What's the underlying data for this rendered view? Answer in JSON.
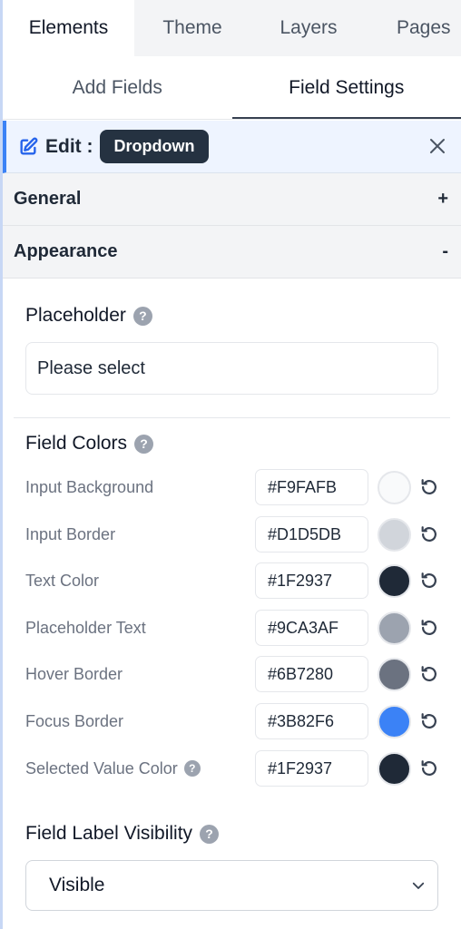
{
  "top_tabs": [
    "Elements",
    "Theme",
    "Layers",
    "Pages"
  ],
  "sub_tabs": [
    "Add Fields",
    "Field Settings"
  ],
  "edit": {
    "label": "Edit :",
    "badge": "Dropdown"
  },
  "accordions": [
    {
      "title": "General",
      "state": "+"
    },
    {
      "title": "Appearance",
      "state": "-"
    }
  ],
  "placeholder": {
    "title": "Placeholder",
    "value": "Please select"
  },
  "field_colors": {
    "title": "Field Colors",
    "rows": [
      {
        "label": "Input Background",
        "hex": "#F9FAFB"
      },
      {
        "label": "Input Border",
        "hex": "#D1D5DB"
      },
      {
        "label": "Text Color",
        "hex": "#1F2937"
      },
      {
        "label": "Placeholder Text",
        "hex": "#9CA3AF"
      },
      {
        "label": "Hover Border",
        "hex": "#6B7280"
      },
      {
        "label": "Focus Border",
        "hex": "#3B82F6"
      },
      {
        "label": "Selected Value Color",
        "hex": "#1F2937"
      }
    ]
  },
  "label_visibility": {
    "title": "Field Label Visibility",
    "value": "Visible"
  },
  "colors": {
    "accent": "#3B82F6",
    "badge_bg": "#253241"
  }
}
